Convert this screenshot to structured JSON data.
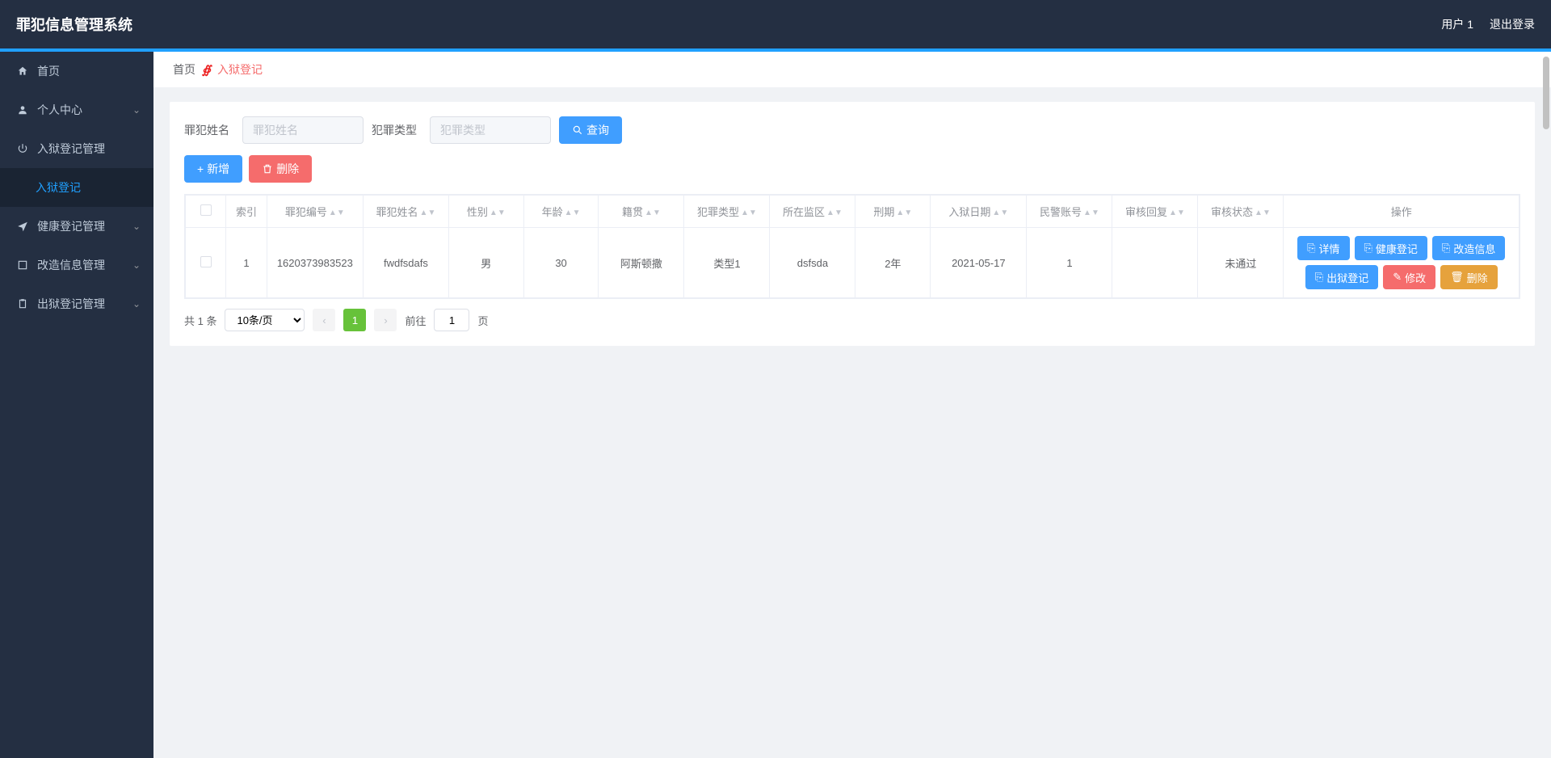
{
  "header": {
    "title": "罪犯信息管理系统",
    "user": "用户 1",
    "logout": "退出登录"
  },
  "sidebar": {
    "items": [
      {
        "id": "home",
        "label": "首页",
        "icon": "home"
      },
      {
        "id": "personal",
        "label": "个人中心",
        "icon": "user",
        "expandable": true
      },
      {
        "id": "incarceration",
        "label": "入狱登记管理",
        "icon": "power",
        "expandable": true,
        "expanded": true,
        "children": [
          {
            "id": "incarceration-reg",
            "label": "入狱登记",
            "active": true
          }
        ]
      },
      {
        "id": "health",
        "label": "健康登记管理",
        "icon": "send",
        "expandable": true
      },
      {
        "id": "reform",
        "label": "改造信息管理",
        "icon": "square",
        "expandable": true
      },
      {
        "id": "release",
        "label": "出狱登记管理",
        "icon": "clipboard",
        "expandable": true
      }
    ]
  },
  "breadcrumb": {
    "home": "首页",
    "current": "入狱登记"
  },
  "filters": {
    "name_label": "罪犯姓名",
    "name_placeholder": "罪犯姓名",
    "crime_label": "犯罪类型",
    "crime_placeholder": "犯罪类型",
    "search_label": "查询"
  },
  "actions": {
    "add": "新增",
    "delete": "删除"
  },
  "table": {
    "columns": [
      "索引",
      "罪犯编号",
      "罪犯姓名",
      "性别",
      "年龄",
      "籍贯",
      "犯罪类型",
      "所在监区",
      "刑期",
      "入狱日期",
      "民警账号",
      "审核回复",
      "审核状态",
      "操作"
    ],
    "rows": [
      {
        "index": "1",
        "number": "1620373983523",
        "name": "fwdfsdafs",
        "gender": "男",
        "age": "30",
        "origin": "阿斯顿撒",
        "crime_type": "类型1",
        "area": "dsfsda",
        "sentence": "2年",
        "date": "2021-05-17",
        "police": "1",
        "review_reply": "",
        "review_status": "未通过"
      }
    ],
    "ops": {
      "detail": "详情",
      "health": "健康登记",
      "reform": "改造信息",
      "release": "出狱登记",
      "edit": "修改",
      "delete": "删除"
    }
  },
  "pagination": {
    "total_text": "共 1 条",
    "per_page": "10条/页",
    "current": "1",
    "goto_prefix": "前往",
    "goto_value": "1",
    "goto_suffix": "页"
  }
}
